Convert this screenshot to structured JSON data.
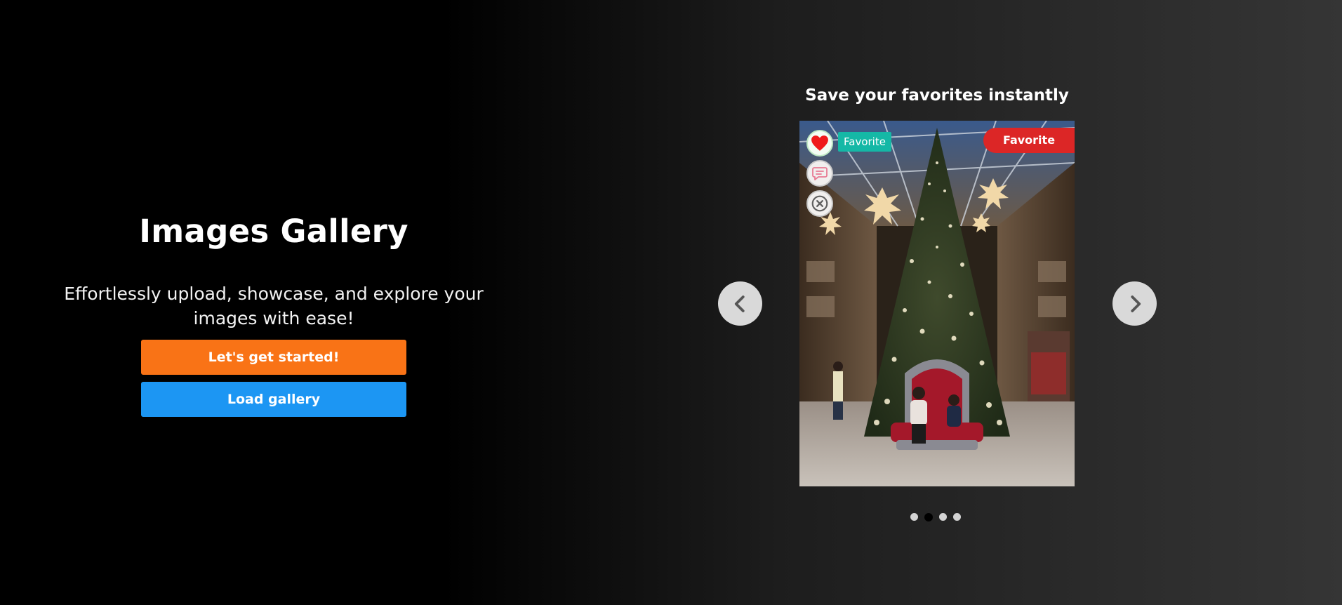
{
  "hero": {
    "title": "Images Gallery",
    "subtitle": "Effortlessly upload, showcase, and explore your images with ease!",
    "start_button": "Let's get started!",
    "load_button": "Load gallery"
  },
  "carousel": {
    "caption": "Save your favorites instantly",
    "favorite_tag": "Favorite",
    "favorite_ribbon": "Favorite",
    "actions": [
      "heart-icon",
      "comment-icon",
      "close-circle-icon"
    ],
    "prev_icon": "chevron-left-icon",
    "next_icon": "chevron-right-icon",
    "slides_count": 4,
    "active_slide": 2,
    "photo_description_icon": "christmas-tree-photo"
  },
  "colors": {
    "start_button": "#f97316",
    "load_button": "#1c96f3",
    "favorite_tag": "#15b8a6",
    "favorite_ribbon": "#dc2626",
    "heart": "#ef1b1b"
  }
}
